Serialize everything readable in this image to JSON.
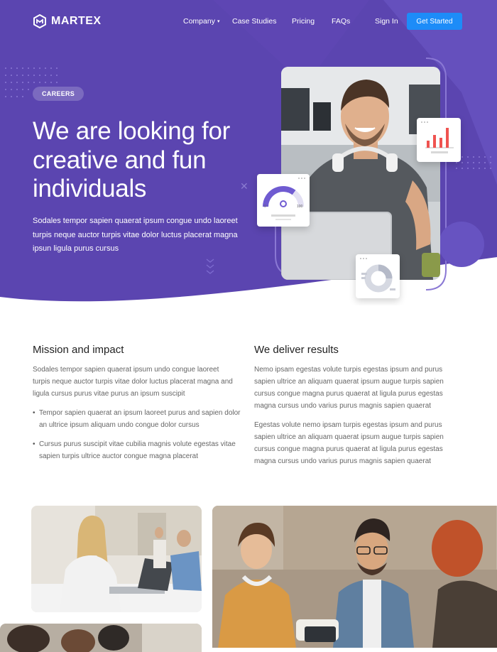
{
  "brand": {
    "name": "MARTEX"
  },
  "nav": {
    "items": [
      {
        "label": "Company",
        "has_dropdown": true
      },
      {
        "label": "Case Studies"
      },
      {
        "label": "Pricing"
      },
      {
        "label": "FAQs"
      }
    ],
    "signin": "Sign In",
    "cta": "Get Started"
  },
  "hero": {
    "badge": "CAREERS",
    "headline": "We are looking for creative and fun individuals",
    "subtext": "Sodales tempor sapien quaerat ipsum congue undo laoreet turpis neque auctor turpis vitae dolor luctus placerat magna ipsun ligula purus cursus",
    "gauge_min": "0",
    "gauge_max": "100"
  },
  "mission": {
    "title": "Mission and impact",
    "paragraph": "Sodales tempor sapien quaerat ipsum undo congue laoreet turpis neque auctor turpis vitae dolor luctus placerat magna and ligula cursus purus vitae purus an ipsum suscipit",
    "bullets": [
      "Tempor sapien quaerat an ipsum laoreet purus and sapien dolor an ultrice ipsum aliquam undo congue dolor cursus",
      "Cursus purus suscipit vitae cubilia magnis volute egestas vitae sapien turpis ultrice auctor congue magna placerat"
    ]
  },
  "results": {
    "title": "We deliver results",
    "paragraphs": [
      "Nemo ipsam egestas volute turpis egestas ipsum and purus sapien ultrice an aliquam quaerat ipsum augue turpis sapien cursus congue magna purus quaerat at ligula purus egestas magna cursus undo varius purus magnis sapien quaerat",
      "Egestas volute nemo ipsam turpis egestas ipsum and purus sapien ultrice an aliquam quaerat ipsum augue turpis sapien cursus congue magna purus quaerat at ligula purus egestas magna cursus undo varius purus magnis sapien quaerat"
    ]
  },
  "colors": {
    "hero_bg": "#5b45b0",
    "accent_button": "#1d8cf8",
    "chart_red": "#ef5350",
    "gauge_purple": "#6f5bd1"
  }
}
